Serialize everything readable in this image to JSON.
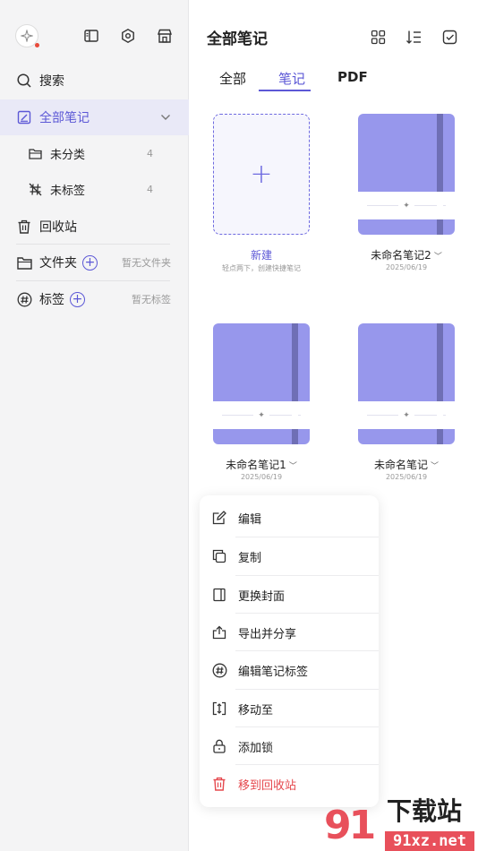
{
  "sidebar": {
    "search_label": "搜索",
    "all_notes_label": "全部笔记",
    "uncategorized_label": "未分类",
    "uncategorized_count": "4",
    "untagged_label": "未标签",
    "untagged_count": "4",
    "trash_label": "回收站",
    "folders_label": "文件夹",
    "folders_hint": "暂无文件夹",
    "tags_label": "标签",
    "tags_hint": "暂无标签"
  },
  "main": {
    "title": "全部笔记",
    "tabs": [
      {
        "label": "全部"
      },
      {
        "label": "笔记"
      },
      {
        "label": "PDF"
      }
    ],
    "active_tab": "笔记",
    "new_card": {
      "plus": "+",
      "label": "新建",
      "hint": "轻点两下，创建快捷笔记"
    },
    "notes": [
      {
        "name": "未命名笔记2",
        "date": "2025/06/19"
      },
      {
        "name": "未命名笔记1",
        "date": "2025/06/19"
      },
      {
        "name": "未命名笔记",
        "date": "2025/06/19"
      }
    ]
  },
  "context_menu": {
    "items": [
      {
        "label": "编辑",
        "icon": "edit-icon"
      },
      {
        "label": "复制",
        "icon": "copy-icon"
      },
      {
        "label": "更换封面",
        "icon": "cover-icon"
      },
      {
        "label": "导出并分享",
        "icon": "share-icon"
      },
      {
        "label": "编辑笔记标签",
        "icon": "hashtag-icon"
      },
      {
        "label": "移动至",
        "icon": "move-icon"
      },
      {
        "label": "添加锁",
        "icon": "lock-icon"
      },
      {
        "label": "移到回收站",
        "icon": "trash-icon"
      }
    ]
  },
  "watermark": {
    "title": "下载站",
    "url": "91xz.net",
    "logo": "91"
  },
  "colors": {
    "accent": "#5c58d6",
    "cover": "#9797ec",
    "strap": "#6f6fb5",
    "danger": "#e5484d"
  }
}
